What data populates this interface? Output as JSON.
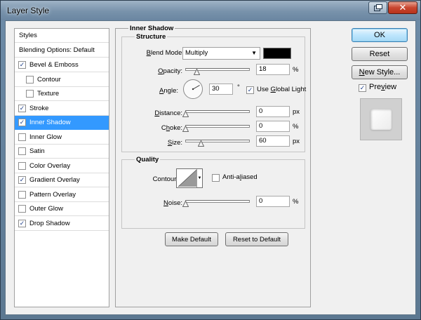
{
  "window": {
    "title": "Layer Style",
    "help_glyph": "⧉",
    "close_glyph": "✕"
  },
  "styles_list": {
    "header": "Styles",
    "blending": "Blending Options: Default",
    "items": [
      {
        "label": "Bevel & Emboss",
        "checked": true,
        "indent": false,
        "selected": false
      },
      {
        "label": "Contour",
        "checked": false,
        "indent": true,
        "selected": false
      },
      {
        "label": "Texture",
        "checked": false,
        "indent": true,
        "selected": false
      },
      {
        "label": "Stroke",
        "checked": true,
        "indent": false,
        "selected": false
      },
      {
        "label": "Inner Shadow",
        "checked": true,
        "indent": false,
        "selected": true
      },
      {
        "label": "Inner Glow",
        "checked": false,
        "indent": false,
        "selected": false
      },
      {
        "label": "Satin",
        "checked": false,
        "indent": false,
        "selected": false
      },
      {
        "label": "Color Overlay",
        "checked": false,
        "indent": false,
        "selected": false
      },
      {
        "label": "Gradient Overlay",
        "checked": true,
        "indent": false,
        "selected": false
      },
      {
        "label": "Pattern Overlay",
        "checked": false,
        "indent": false,
        "selected": false
      },
      {
        "label": "Outer Glow",
        "checked": false,
        "indent": false,
        "selected": false
      },
      {
        "label": "Drop Shadow",
        "checked": true,
        "indent": false,
        "selected": false
      }
    ]
  },
  "inner_shadow": {
    "title": "Inner Shadow",
    "structure": {
      "title": "Structure",
      "blend_mode_label_u": "B",
      "blend_mode_label_rest": "lend Mode:",
      "blend_mode_value": "Multiply",
      "shadow_color": "#000000",
      "opacity_label_u": "O",
      "opacity_label_rest": "pacity:",
      "opacity_value": "18",
      "opacity_unit": "%",
      "opacity_fraction": 0.18,
      "angle_label_u": "A",
      "angle_label_rest": "ngle:",
      "angle_value": "30",
      "angle_unit": "°",
      "use_global_light_pre": "Use ",
      "use_global_light_u": "G",
      "use_global_light_post": "lobal Light",
      "use_global_light": true,
      "distance_label_u": "D",
      "distance_label_rest": "istance:",
      "distance_value": "0",
      "distance_unit": "px",
      "distance_fraction": 0.0,
      "choke_label_u": "h",
      "choke_label_pre": "C",
      "choke_label_post": "oke:",
      "choke_value": "0",
      "choke_unit": "%",
      "choke_fraction": 0.0,
      "size_label_u": "S",
      "size_label_rest": "ize:",
      "size_value": "60",
      "size_unit": "px",
      "size_fraction": 0.24
    },
    "quality": {
      "title": "Quality",
      "contour_label": "Contour:",
      "anti_aliased_pre": "Anti-a",
      "anti_aliased_u": "l",
      "anti_aliased_post": "iased",
      "anti_aliased": false,
      "noise_label_u": "N",
      "noise_label_rest": "oise:",
      "noise_value": "0",
      "noise_unit": "%",
      "noise_fraction": 0.0
    },
    "make_default": "Make Default",
    "reset_default": "Reset to Default"
  },
  "right": {
    "ok": "OK",
    "reset": "Reset",
    "new_style_u": "N",
    "new_style_rest": "ew Style...",
    "preview_pre": "Pre",
    "preview_u": "v",
    "preview_post": "iew",
    "preview_checked": true
  }
}
